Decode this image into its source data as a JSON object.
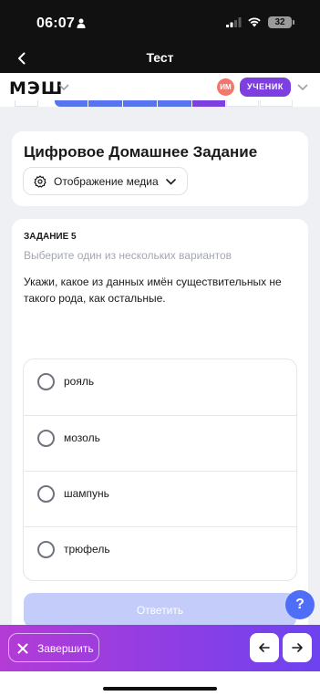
{
  "status_bar": {
    "time": "06:07",
    "battery": "32"
  },
  "nav": {
    "title": "Тест"
  },
  "header": {
    "logo": "МЭШ",
    "avatar_initials": "ИМ",
    "role": "УЧЕНИК"
  },
  "colors": {
    "accent": "#4f6ef7",
    "purple": "#7d3fe0",
    "button_disabled": "#c4cdfa",
    "avatar": "#f0776e"
  },
  "icons": {
    "media": "settings-icon",
    "finish": "close-icon",
    "prev": "arrow-left-icon",
    "next": "arrow-right-icon",
    "help": "question-icon"
  },
  "assignment": {
    "title": "Цифровое Домашнее Задание",
    "media_toggle": "Отображение медиа"
  },
  "task": {
    "number": "ЗАДАНИЕ 5",
    "hint": "Выберите один из нескольких вариантов",
    "question": "Укажи, какое из данных имён существительных не такого рода, как остальные.",
    "options": [
      {
        "label": "рояль",
        "selected": false
      },
      {
        "label": "мозоль",
        "selected": false
      },
      {
        "label": "шампунь",
        "selected": false
      },
      {
        "label": "трюфель",
        "selected": false
      }
    ],
    "answer_button": "Ответить"
  },
  "help": {
    "label": "?"
  },
  "footer": {
    "finish_label": "Завершить"
  }
}
